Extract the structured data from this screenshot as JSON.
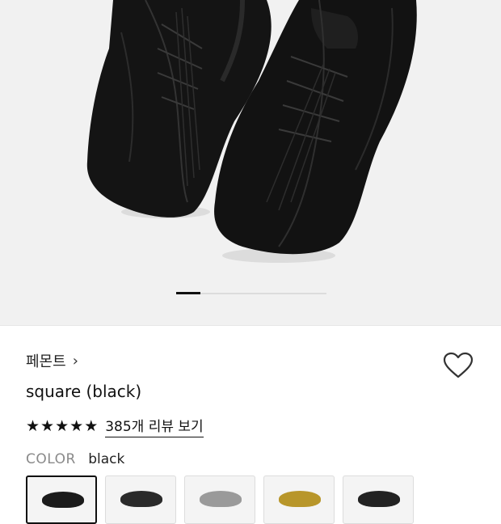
{
  "product": {
    "brand": "페몬트",
    "brand_chevron": "›",
    "title": "square (black)",
    "rating_stars": 5,
    "reviews_link": "385개 리뷰 보기"
  },
  "gallery": {
    "current_page": 1
  },
  "options": {
    "color_label": "COLOR",
    "color_value": "black",
    "swatches": [
      {
        "name": "black",
        "color": "#1b1b1b",
        "selected": true
      },
      {
        "name": "dark",
        "color": "#2a2a2a",
        "selected": false
      },
      {
        "name": "silver",
        "color": "#9a9a9a",
        "selected": false
      },
      {
        "name": "gold",
        "color": "#b8962a",
        "selected": false
      },
      {
        "name": "black2",
        "color": "#222222",
        "selected": false
      }
    ]
  },
  "colors": {
    "hero_bg": "#f1f1f1",
    "accent": "#111111"
  }
}
